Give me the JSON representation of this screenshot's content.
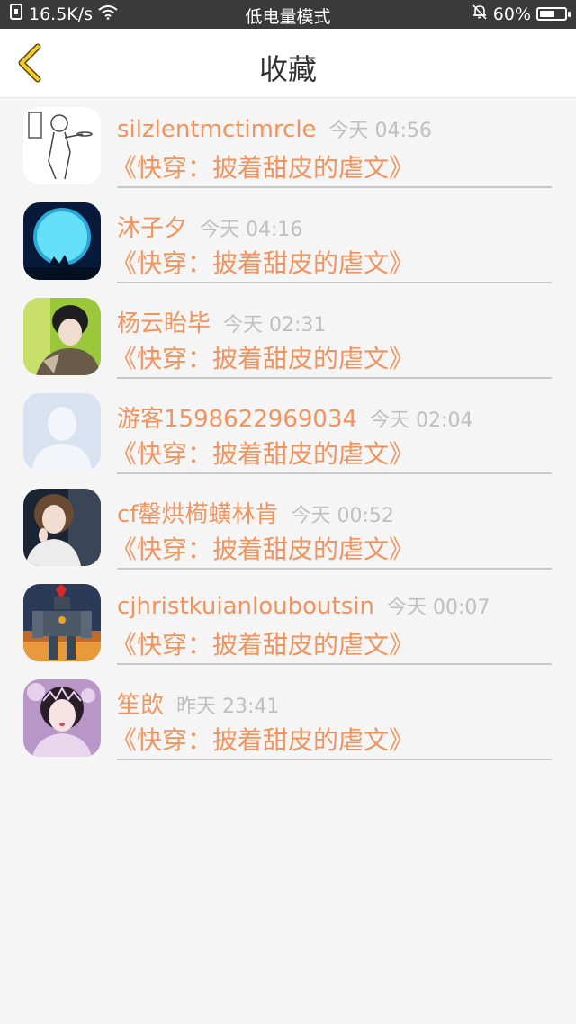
{
  "status_bar": {
    "network_speed": "16.5K/s",
    "mode": "低电量模式",
    "battery": "60%",
    "battery_level": 0.6
  },
  "header": {
    "title": "收藏",
    "back_icon": "chevron-left-icon"
  },
  "items": [
    {
      "name": "silzlentmctimrcle",
      "time": "今天 04:56",
      "book": "《快穿：披着甜皮的虐文》"
    },
    {
      "name": "沐子夕",
      "time": "今天 04:16",
      "book": "《快穿：披着甜皮的虐文》"
    },
    {
      "name": "杨云眙毕",
      "time": "今天 02:31",
      "book": "《快穿：披着甜皮的虐文》"
    },
    {
      "name": "游客1598622969034",
      "time": "今天 02:04",
      "book": "《快穿：披着甜皮的虐文》"
    },
    {
      "name": "cf罄烘槆蟥林肯",
      "time": "今天 00:52",
      "book": "《快穿：披着甜皮的虐文》"
    },
    {
      "name": "cjhristkuianlouboutsin",
      "time": "今天 00:07",
      "book": "《快穿：披着甜皮的虐文》"
    },
    {
      "name": "笙欴",
      "time": "昨天 23:41",
      "book": "《快穿：披着甜皮的虐文》"
    }
  ],
  "colors": {
    "accent": "#f0945f",
    "time_gray": "#bfbfbf",
    "back_icon": "#e8c020"
  }
}
